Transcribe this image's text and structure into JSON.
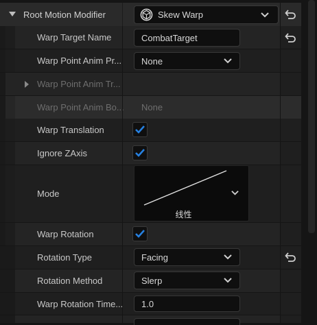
{
  "header": {
    "title": "Root Motion Modifier",
    "selected": "Skew Warp"
  },
  "rows": {
    "warp_target_name": {
      "label": "Warp Target Name",
      "value": "CombatTarget"
    },
    "warp_point_anim_provider": {
      "label": "Warp Point Anim Pr...",
      "value": "None"
    },
    "warp_point_anim_transform": {
      "label": "Warp Point Anim Tr..."
    },
    "warp_point_anim_bone": {
      "label": "Warp Point Anim Bo...",
      "value": "None"
    },
    "warp_translation": {
      "label": "Warp Translation",
      "checked": true
    },
    "ignore_zaxis": {
      "label": "Ignore ZAxis",
      "checked": true
    },
    "mode": {
      "label": "Mode",
      "curve_label": "线性"
    },
    "warp_rotation": {
      "label": "Warp Rotation",
      "checked": true
    },
    "rotation_type": {
      "label": "Rotation Type",
      "value": "Facing"
    },
    "rotation_method": {
      "label": "Rotation Method",
      "value": "Slerp"
    },
    "warp_rotation_time": {
      "label": "Warp Rotation Time...",
      "value": "1.0"
    }
  },
  "colors": {
    "accent_check": "#2680e0",
    "panel_bg": "#242424",
    "field_bg": "#0f0f0f"
  }
}
